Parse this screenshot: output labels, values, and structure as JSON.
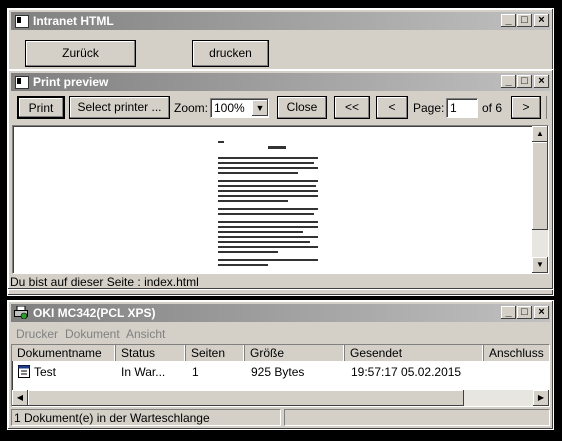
{
  "main_window": {
    "title": "Intranet HTML",
    "back_label": "Zurück",
    "print_label": "drucken"
  },
  "preview_window": {
    "title": "Print preview",
    "print_label": "Print",
    "select_printer_label": "Select printer ...",
    "zoom_label": "Zoom:",
    "zoom_value": "100%",
    "close_label": "Close",
    "first_label": "<<",
    "prev_label": "<",
    "page_label": "Page:",
    "page_value": "1",
    "page_of": "of 6",
    "next_label": ">",
    "status_text": "Du bist auf dieser Seite : index.html"
  },
  "queue_window": {
    "title": "OKI MC342(PCL XPS)",
    "menu": [
      "Drucker",
      "Dokument",
      "Ansicht"
    ],
    "columns": [
      "Dokumentname",
      "Status",
      "Seiten",
      "Größe",
      "Gesendet",
      "Anschluss"
    ],
    "rows": [
      {
        "name": "Test",
        "status": "In War...",
        "pages": "1",
        "size": "925 Bytes",
        "sent": "19:57:17  05.02.2015",
        "port": ""
      }
    ],
    "status_text": "1 Dokument(e) in der Warteschlange"
  },
  "window_controls": {
    "minimize": "_",
    "maximize": "□",
    "close": "×"
  },
  "icons": {
    "window": "window-icon",
    "printer": "printer-icon",
    "document": "document-icon"
  }
}
